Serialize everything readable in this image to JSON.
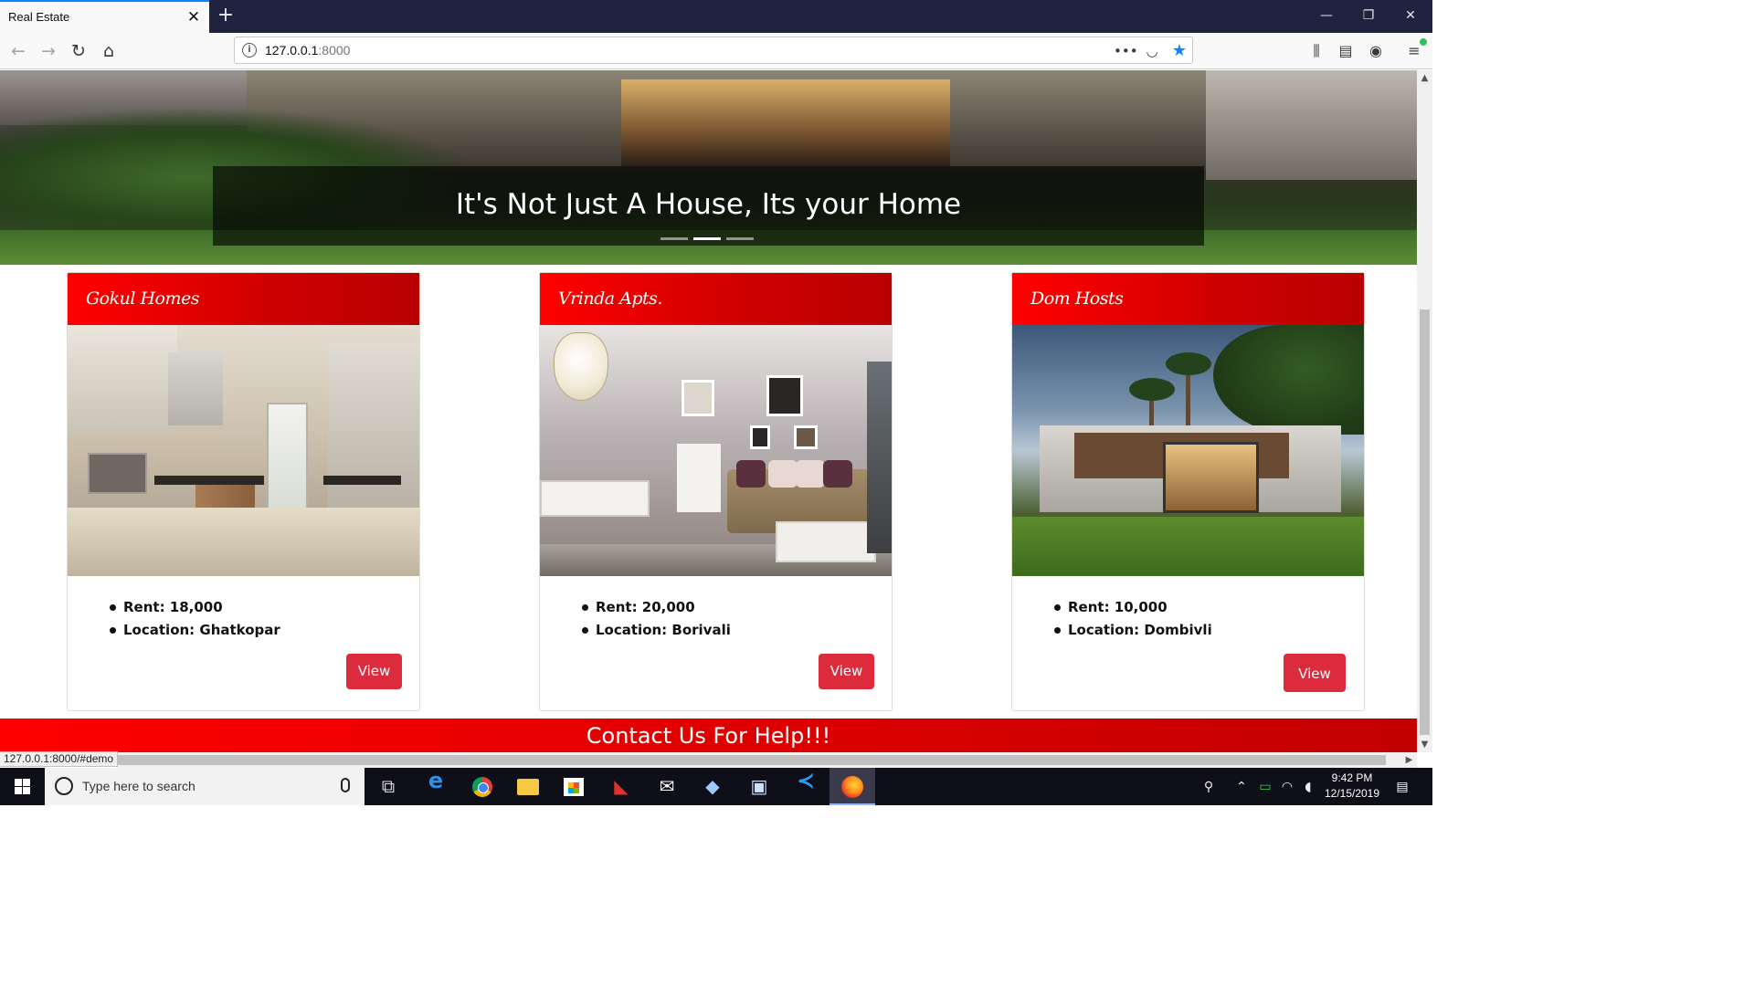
{
  "browser": {
    "tab_title": "Real Estate",
    "tab_close": "✕",
    "new_tab": "+",
    "url_host": "127.0.0.1",
    "url_port": ":8000",
    "status_url": "127.0.0.1:8000/#demo",
    "accent": "#0a84ff"
  },
  "hero": {
    "caption": "It's Not Just A House, Its your Home",
    "indicators": 3,
    "active_indicator": 2
  },
  "cards": [
    {
      "title": "Gokul Homes",
      "rent": "Rent: 18,000",
      "location": "Location: Ghatkopar",
      "button": "View"
    },
    {
      "title": "Vrinda Apts.",
      "rent": "Rent: 20,000",
      "location": "Location: Borivali",
      "button": "View"
    },
    {
      "title": "Dom Hosts",
      "rent": "Rent: 10,000",
      "location": "Location: Dombivli",
      "button": "View"
    }
  ],
  "contact": {
    "text": "Contact Us For Help!!!",
    "color": "#ff0000"
  },
  "taskbar": {
    "search_placeholder": "Type here to search",
    "time": "9:42 PM",
    "date": "12/15/2019"
  }
}
